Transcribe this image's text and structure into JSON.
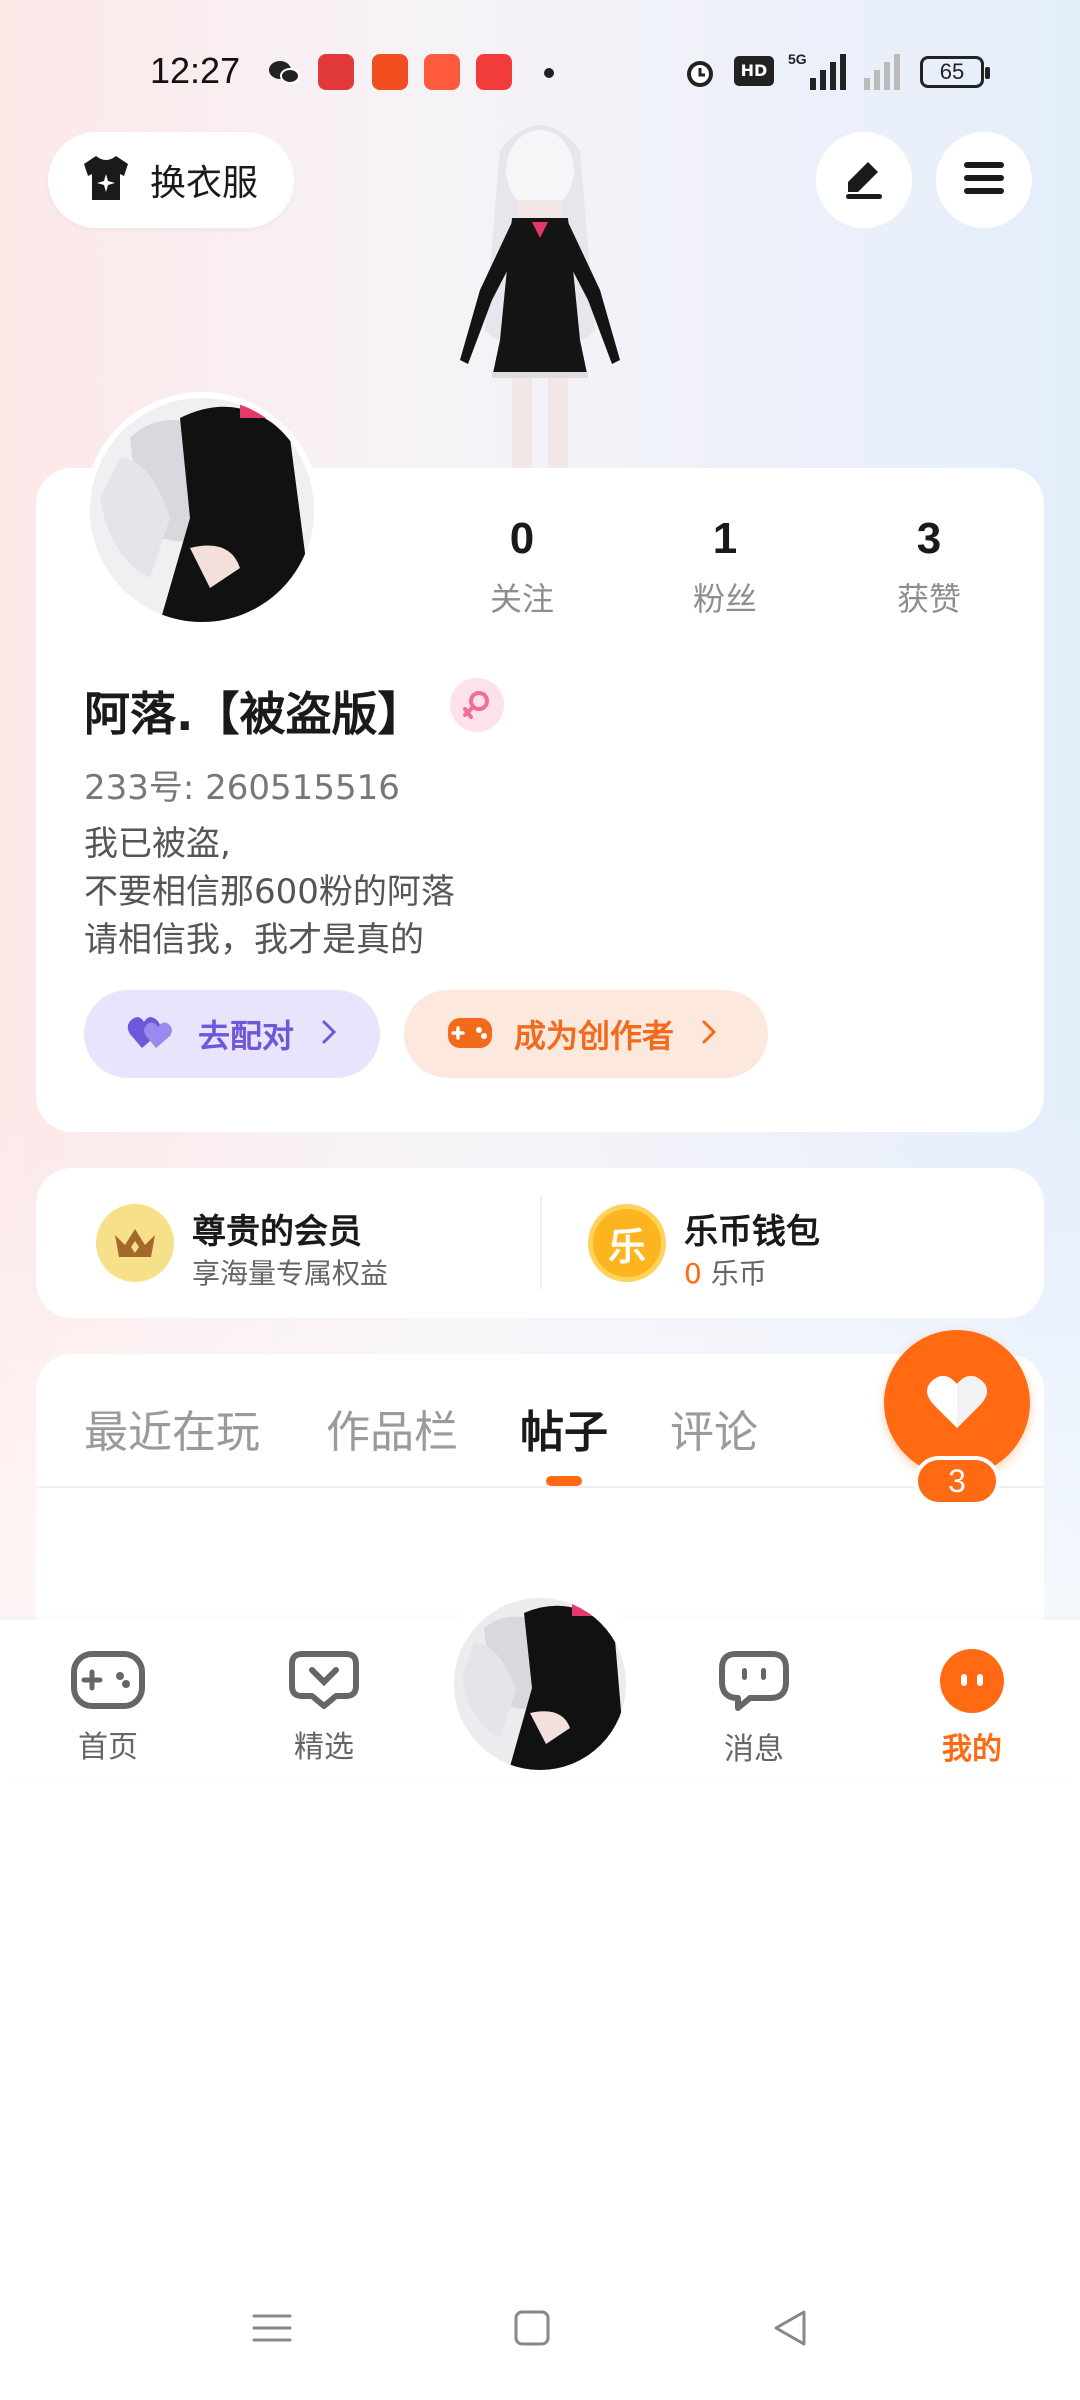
{
  "status_bar": {
    "time": "12:27",
    "battery": "65",
    "network": "5G"
  },
  "header": {
    "outfit_label": "换衣服"
  },
  "profile": {
    "username": "阿落.【被盗版】",
    "uid_label": "233号: 260515516",
    "bio_lines": [
      "我已被盗,",
      "不要相信那600粉的阿落",
      "请相信我，我才是真的"
    ],
    "stats": [
      {
        "value": "0",
        "label": "关注"
      },
      {
        "value": "1",
        "label": "粉丝"
      },
      {
        "value": "3",
        "label": "获赞"
      }
    ],
    "match_label": "去配对",
    "creator_label": "成为创作者"
  },
  "member": {
    "vip_title": "尊贵的会员",
    "vip_sub": "享海量专属权益",
    "coin_icon_text": "乐",
    "wallet_title": "乐币钱包",
    "wallet_amount": "0",
    "wallet_unit": "乐币"
  },
  "tabs": [
    {
      "label": "最近在玩",
      "active": false
    },
    {
      "label": "作品栏",
      "active": false
    },
    {
      "label": "帖子",
      "active": true
    },
    {
      "label": "评论",
      "active": false
    }
  ],
  "like_count": "3",
  "bottom_nav": [
    {
      "label": "首页",
      "icon": "gamepad-icon"
    },
    {
      "label": "精选",
      "icon": "heart-chat-icon"
    },
    {
      "label": "消息",
      "icon": "message-icon"
    },
    {
      "label": "我的",
      "icon": "profile-face-icon",
      "active": true
    }
  ],
  "colors": {
    "accent": "#ff6a12",
    "match": "#6d58d9"
  }
}
